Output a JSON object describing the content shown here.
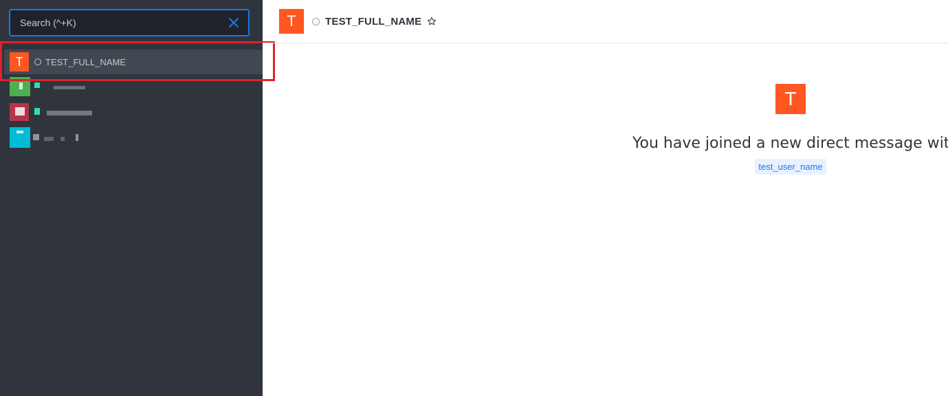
{
  "search": {
    "placeholder": "Search (^+K)"
  },
  "sidebar": {
    "items": [
      {
        "name": "TEST_FULL_NAME",
        "avatar_letter": "T",
        "avatar_color": "#ff5722",
        "active": true,
        "status_color": "#c6c9cc"
      }
    ]
  },
  "header": {
    "avatar_letter": "T",
    "title": "TEST_FULL_NAME",
    "star_icon": "star-outline-icon"
  },
  "welcome": {
    "avatar_letter": "T",
    "message": "You have joined a new direct message with",
    "username": "test_user_name"
  },
  "colors": {
    "accent": "#1d74f5",
    "avatar_orange": "#ff5722",
    "sidebar_bg": "#2f343d",
    "highlight": "#e0212b"
  }
}
